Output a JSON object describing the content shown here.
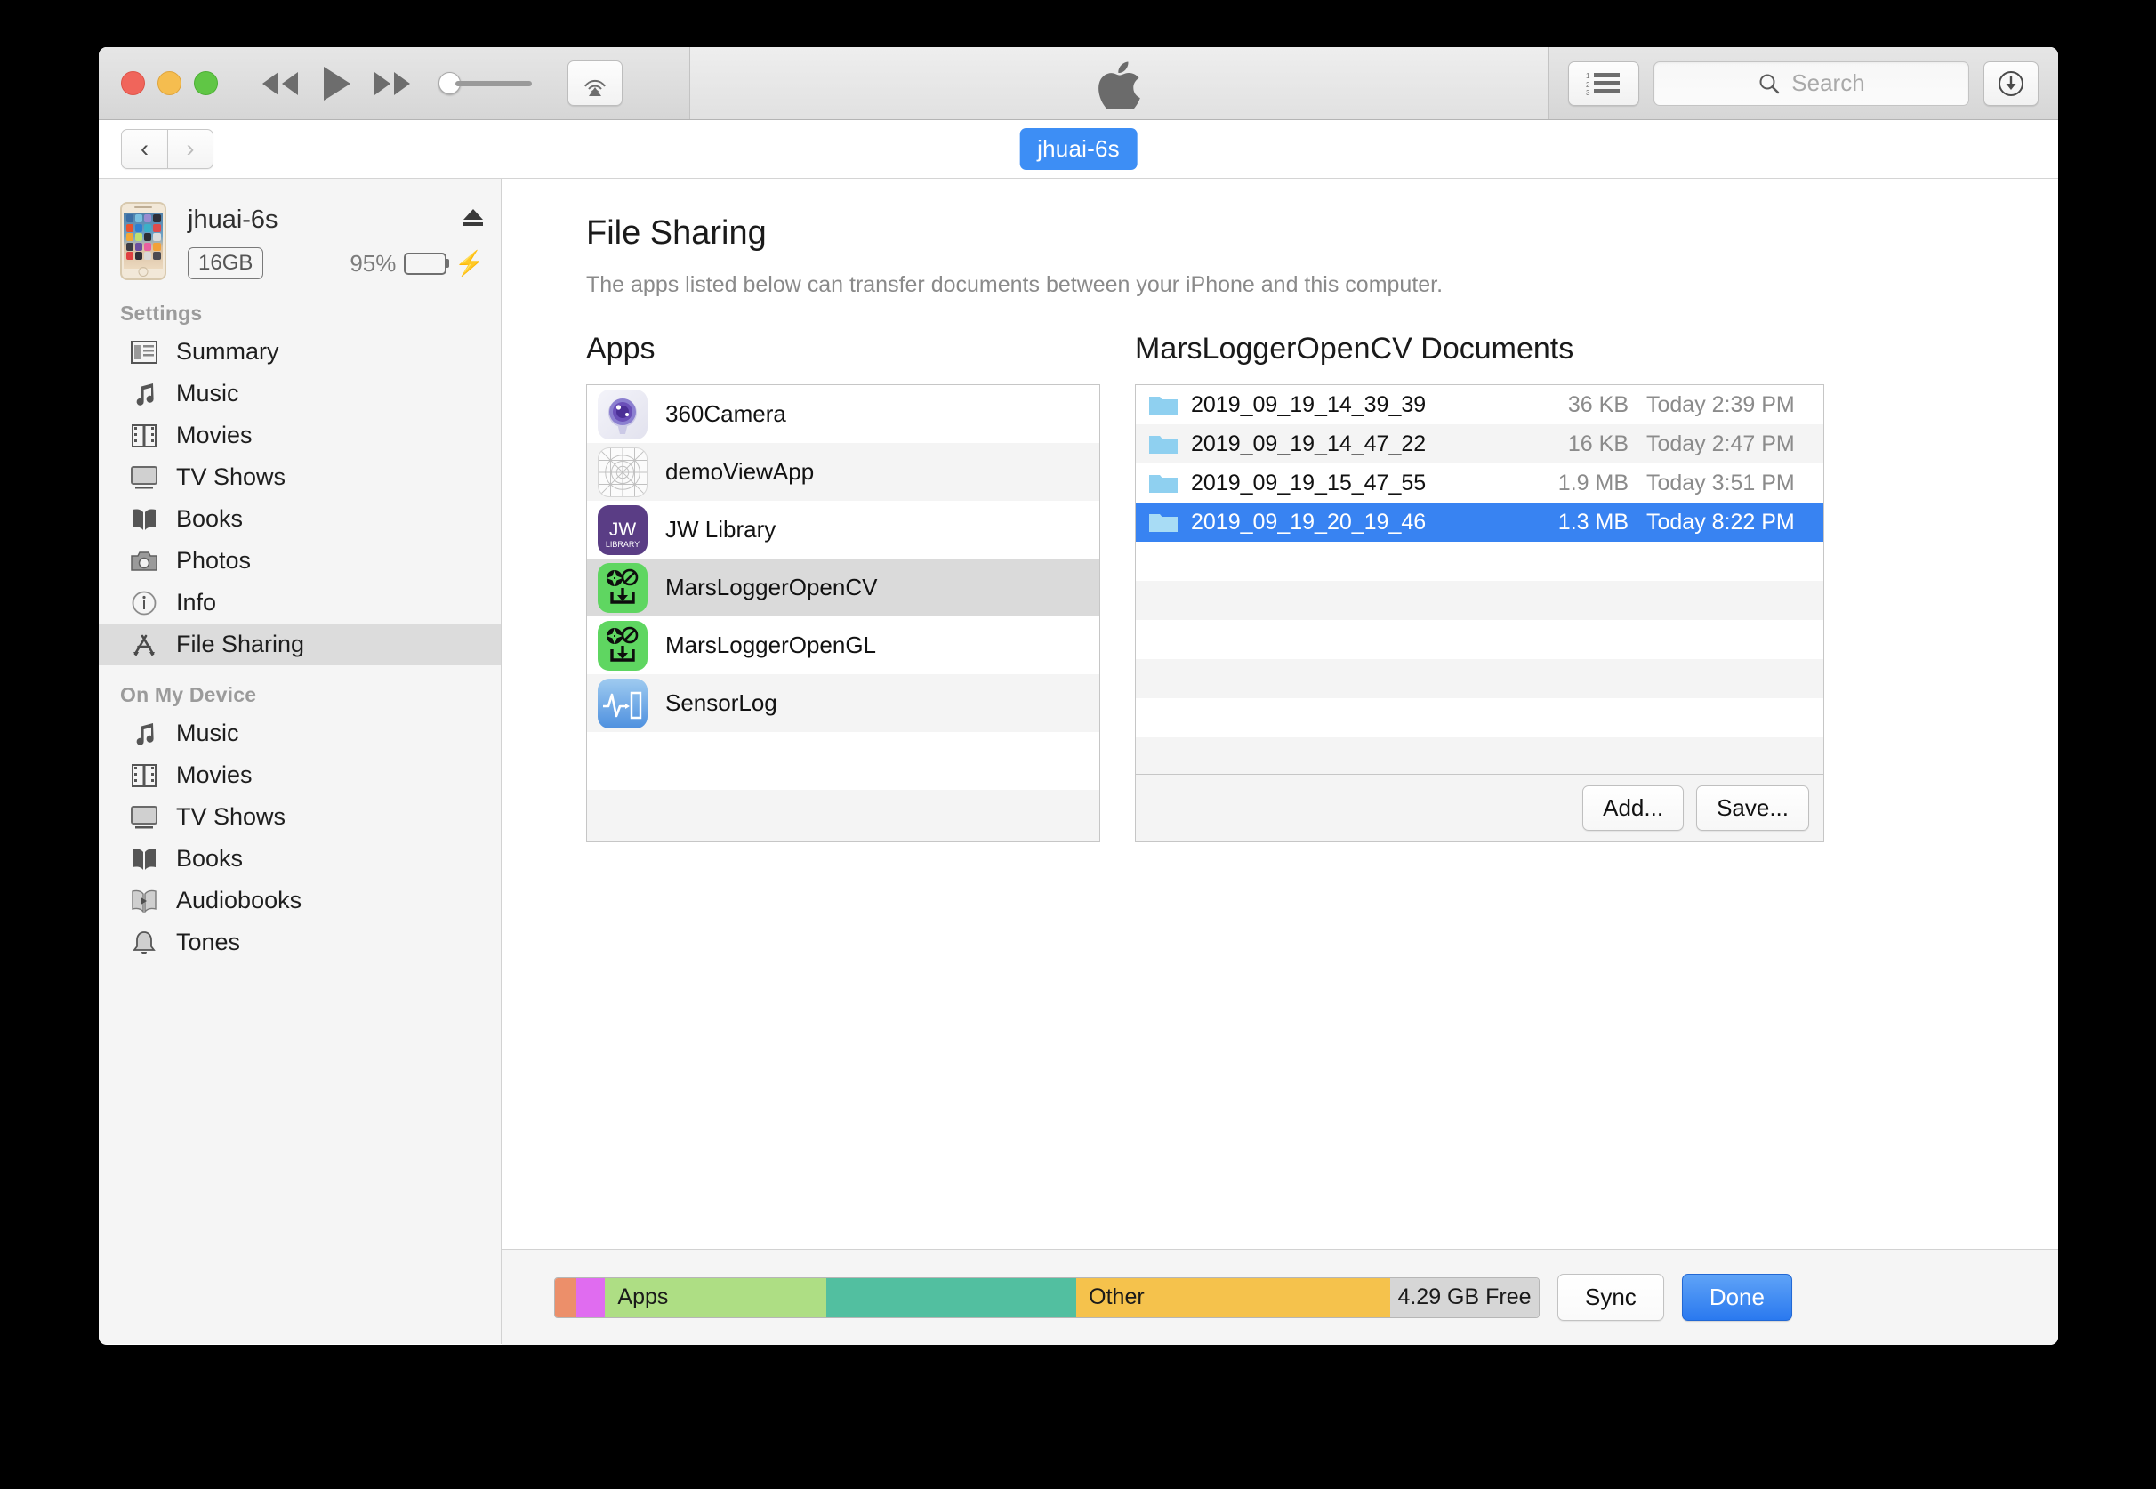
{
  "window": {
    "titlebar": {
      "traffic_lights": [
        "close",
        "minimize",
        "maximize"
      ],
      "transport": [
        "rewind",
        "play",
        "fast-forward"
      ],
      "volume_value": "0",
      "airplay_label": "AirPlay",
      "apple_logo": "apple-logo",
      "list_view_label": "List View",
      "search": {
        "placeholder": "Search",
        "value": ""
      },
      "downloads_label": "Downloads"
    },
    "navbar": {
      "back_label": "‹",
      "forward_label": "›",
      "device_tab": "jhuai-6s"
    }
  },
  "sidebar": {
    "device": {
      "name": "jhuai-6s",
      "capacity": "16GB",
      "battery_percent": "95%",
      "battery_level": 95,
      "charging": true,
      "eject_label": "Eject"
    },
    "groups": [
      {
        "title": "Settings",
        "items": [
          {
            "label": "Summary",
            "icon": "summary-icon",
            "selected": false
          },
          {
            "label": "Music",
            "icon": "music-note-icon",
            "selected": false
          },
          {
            "label": "Movies",
            "icon": "film-icon",
            "selected": false
          },
          {
            "label": "TV Shows",
            "icon": "tv-icon",
            "selected": false
          },
          {
            "label": "Books",
            "icon": "book-icon",
            "selected": false
          },
          {
            "label": "Photos",
            "icon": "camera-icon",
            "selected": false
          },
          {
            "label": "Info",
            "icon": "info-icon",
            "selected": false
          },
          {
            "label": "File Sharing",
            "icon": "app-store-icon",
            "selected": true
          }
        ]
      },
      {
        "title": "On My Device",
        "items": [
          {
            "label": "Music",
            "icon": "music-note-icon",
            "selected": false
          },
          {
            "label": "Movies",
            "icon": "film-icon",
            "selected": false
          },
          {
            "label": "TV Shows",
            "icon": "tv-icon",
            "selected": false
          },
          {
            "label": "Books",
            "icon": "book-icon",
            "selected": false
          },
          {
            "label": "Audiobooks",
            "icon": "audiobook-icon",
            "selected": false
          },
          {
            "label": "Tones",
            "icon": "bell-icon",
            "selected": false
          }
        ]
      }
    ]
  },
  "main": {
    "title": "File Sharing",
    "description": "The apps listed below can transfer documents between your iPhone and this computer.",
    "apps_column": {
      "heading": "Apps",
      "apps": [
        {
          "name": "360Camera",
          "icon": "camera360-app-icon",
          "selected": false
        },
        {
          "name": "demoViewApp",
          "icon": "demoview-app-icon",
          "selected": false
        },
        {
          "name": "JW Library",
          "icon": "jw-library-app-icon",
          "selected": false
        },
        {
          "name": "MarsLoggerOpenCV",
          "icon": "marslogger-app-icon",
          "selected": true
        },
        {
          "name": "MarsLoggerOpenGL",
          "icon": "marslogger-app-icon",
          "selected": false
        },
        {
          "name": "SensorLog",
          "icon": "sensorlog-app-icon",
          "selected": false
        }
      ]
    },
    "documents_column": {
      "heading": "MarsLoggerOpenCV Documents",
      "documents": [
        {
          "name": "2019_09_19_14_39_39",
          "size": "36 KB",
          "date": "Today 2:39 PM",
          "icon": "folder-icon",
          "selected": false
        },
        {
          "name": "2019_09_19_14_47_22",
          "size": "16 KB",
          "date": "Today 2:47 PM",
          "icon": "folder-icon",
          "selected": false
        },
        {
          "name": "2019_09_19_15_47_55",
          "size": "1.9 MB",
          "date": "Today 3:51 PM",
          "icon": "folder-icon",
          "selected": false
        },
        {
          "name": "2019_09_19_20_19_46",
          "size": "1.3 MB",
          "date": "Today 8:22 PM",
          "icon": "folder-icon",
          "selected": true
        }
      ],
      "add_button": "Add...",
      "save_button": "Save..."
    }
  },
  "footer": {
    "capacity_bar": [
      {
        "label": "",
        "width_pct": 2.2,
        "color": "#ec8f6a"
      },
      {
        "label": "",
        "width_pct": 2.9,
        "color": "#e06cf0"
      },
      {
        "label": "Apps",
        "width_pct": 22.5,
        "color": "#aede84"
      },
      {
        "label": "",
        "width_pct": 25.4,
        "color": "#52bfa0"
      },
      {
        "label": "Other",
        "width_pct": 31.9,
        "color": "#f5c council"
      },
      {
        "label": "4.29 GB Free",
        "width_pct": 15.1,
        "color": "#d6d6d6"
      }
    ],
    "sync_button": "Sync",
    "done_button": "Done"
  },
  "colors": {
    "accent_blue": "#3883f2",
    "selection_gray": "#dadada",
    "folder_blue": "#8fd0f0",
    "app_green": "#5fd661"
  }
}
